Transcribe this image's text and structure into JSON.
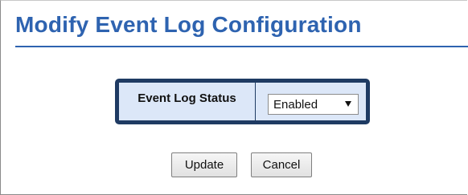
{
  "page": {
    "title": "Modify Event Log Configuration"
  },
  "config": {
    "event_log_status_label": "Event Log Status",
    "event_log_status_value": "Enabled"
  },
  "buttons": {
    "update_label": "Update",
    "cancel_label": "Cancel"
  },
  "colors": {
    "title": "#2e63b0",
    "box_border": "#1f3b63",
    "box_fill": "#dce7f8"
  },
  "icons": {
    "select_arrow": "chevron-down-icon"
  }
}
